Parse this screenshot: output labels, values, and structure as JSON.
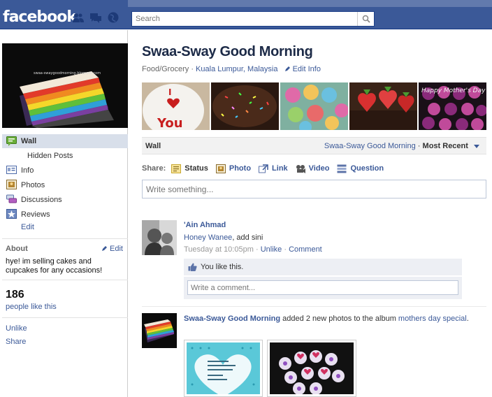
{
  "topbar": {
    "logo": "facebook",
    "search_placeholder": "Search",
    "icons": [
      "friends-icon",
      "messages-icon",
      "notifications-icon",
      "search-icon"
    ]
  },
  "leftcol": {
    "profile_pic_caption": "swaa-swaygoodmorning.blogspot.com",
    "nav": [
      {
        "label": "Wall",
        "icon": "wall-icon",
        "active": true
      },
      {
        "label": "Hidden Posts"
      },
      {
        "label": "Info",
        "icon": "info-icon"
      },
      {
        "label": "Photos",
        "icon": "photos-icon"
      },
      {
        "label": "Discussions",
        "icon": "discussions-icon"
      },
      {
        "label": "Reviews",
        "icon": "reviews-icon"
      },
      {
        "label": "Edit"
      }
    ],
    "about": {
      "title": "About",
      "edit_label": "Edit",
      "text": "hye! im selling cakes and cupcakes for any occasions!"
    },
    "likes": {
      "count": "186",
      "label": "people like this"
    },
    "unlike_label": "Unlike",
    "share_label": "Share"
  },
  "page": {
    "title": "Swaa-Sway Good Morning",
    "category": "Food/Grocery",
    "location": "Kuala Lumpur, Malaysia",
    "edit_info": "Edit Info",
    "strip_text": {
      "heart_photo": "I ♥ You",
      "mothers_photo": "Happy Mother's Day"
    }
  },
  "wall_bar": {
    "title": "Wall",
    "filter_name": "Swaa-Sway Good Morning",
    "sort_label": "Most Recent"
  },
  "share": {
    "label": "Share:",
    "options": [
      {
        "label": "Status",
        "icon": "status-icon"
      },
      {
        "label": "Photo",
        "icon": "photo-icon"
      },
      {
        "label": "Link",
        "icon": "link-icon"
      },
      {
        "label": "Video",
        "icon": "video-icon"
      },
      {
        "label": "Question",
        "icon": "question-icon"
      }
    ],
    "composer_placeholder": "Write something..."
  },
  "stories": [
    {
      "author": "'Ain Ahmad",
      "mention": "Honey Wanee",
      "text": ", add sini",
      "time": "Tuesday at 10:05pm",
      "actions": [
        "Unlike",
        "Comment"
      ],
      "like_text": "You like this.",
      "comment_placeholder": "Write a comment..."
    },
    {
      "author": "Swaa-Sway Good Morning",
      "text": " added 2 new photos to the album ",
      "album": "mothers day special",
      "after": "."
    }
  ],
  "colors": {
    "brand": "#3b5998",
    "brand_dark": "#1c2a47",
    "nav_active": "#d8dfea",
    "panel": "#edeff4"
  }
}
